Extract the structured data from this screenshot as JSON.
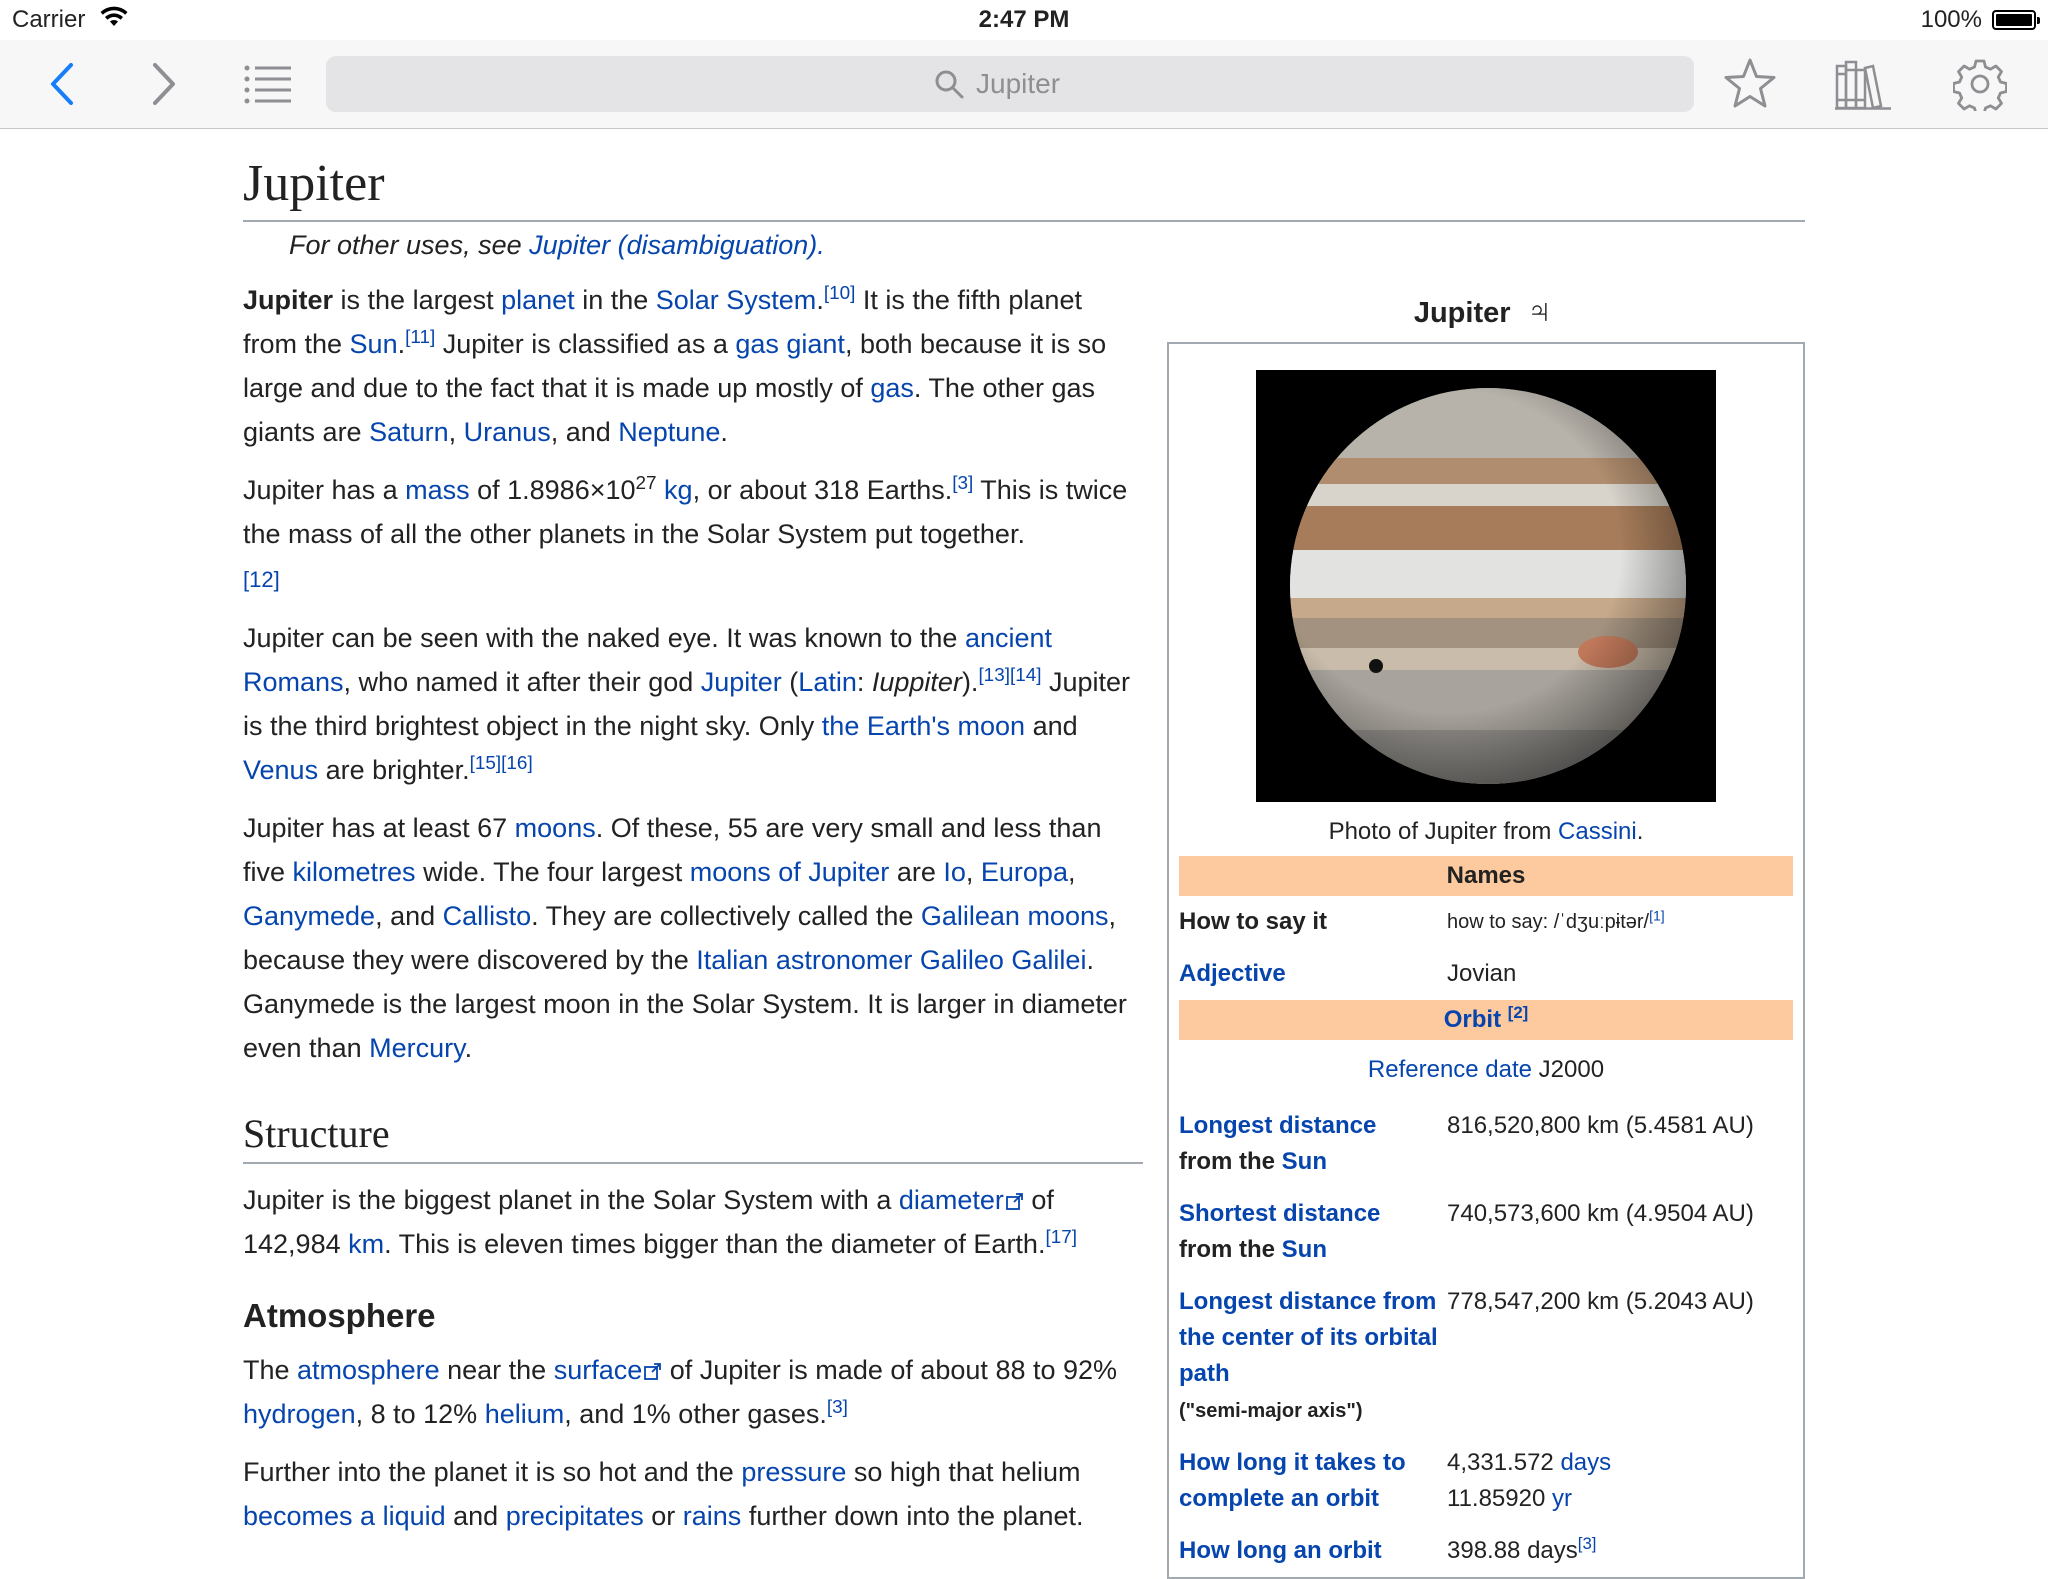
{
  "status": {
    "carrier": "Carrier",
    "time": "2:47 PM",
    "battery": "100%"
  },
  "toolbar": {
    "search_placeholder": "Jupiter"
  },
  "article": {
    "title": "Jupiter",
    "hatnote_pre": "For other uses, see ",
    "hatnote_link": "Jupiter (disambiguation).",
    "p1": {
      "bold": "Jupiter",
      "t1": " is the largest ",
      "l1": "planet",
      "t2": " in the ",
      "l2": "Solar System",
      "t3": ".",
      "r1": "[10]",
      "t4": " It is the fifth planet from the ",
      "l3": "Sun",
      "t5": ".",
      "r2": "[11]",
      "t6": " Jupiter is classified as a ",
      "l4": "gas giant",
      "t7": ", both because it is so large and due to the fact that it is made up mostly of ",
      "l5": "gas",
      "t8": ". The other gas giants are ",
      "l6": "Saturn",
      "t9": ", ",
      "l7": "Uranus",
      "t10": ", and ",
      "l8": "Neptune",
      "t11": "."
    },
    "p2": {
      "t1": "Jupiter has a ",
      "l1": "mass",
      "t2": " of 1.8986×10",
      "sup": "27",
      "t3": " ",
      "l2": "kg",
      "t4": ", or about 318 Earths.",
      "r1": "[3]",
      "t5": " This is twice the mass of all the other planets in the Solar System put together.",
      "r2": "[12]"
    },
    "p3": {
      "t1": "Jupiter can be seen with the naked eye. It was known to the ",
      "l1": "ancient Romans",
      "t2": ", who named it after their god ",
      "l2": "Jupiter",
      "t3": " (",
      "l3": "Latin",
      "t4": ": ",
      "i1": "Iuppiter",
      "t5": ").",
      "r1": "[13][14]",
      "t6": " Jupiter is the third brightest object in the night sky. Only ",
      "l4": "the Earth's moon",
      "t7": " and ",
      "l5": "Venus",
      "t8": " are brighter.",
      "r2": "[15][16]"
    },
    "p4": {
      "t1": "Jupiter has at least 67 ",
      "l1": "moons",
      "t2": ". Of these, 55 are very small and less than five ",
      "l2": "kilometres",
      "t3": " wide. The four largest ",
      "l3": "moons of Jupiter",
      "t4": " are ",
      "l4": "Io",
      "t5": ", ",
      "l5": "Europa",
      "t6": ", ",
      "l6": "Ganymede",
      "t7": ", and ",
      "l7": "Callisto",
      "t8": ". They are collectively called the ",
      "l8": "Galilean moons",
      "t9": ", because they were discovered by the ",
      "l9": "Italian astronomer Galileo Galilei",
      "t10": ". Ganymede is the largest moon in the Solar System. It is larger in diameter even than ",
      "l10": "Mercury",
      "t11": "."
    },
    "structure": {
      "heading": "Structure",
      "t1": "Jupiter is the biggest planet in the Solar System with a ",
      "l1": "diameter",
      "t2": " of 142,984 ",
      "l2": "km",
      "t3": ". This is eleven times bigger than the diameter of Earth.",
      "r1": "[17]"
    },
    "atmosphere": {
      "heading": "Atmosphere",
      "p1": {
        "t1": "The ",
        "l1": "atmosphere",
        "t2": " near the ",
        "l2": "surface",
        "t3": " of Jupiter is made of about 88 to 92% ",
        "l3": "hydrogen",
        "t4": ", 8 to 12% ",
        "l4": "helium",
        "t5": ", and 1% other gases.",
        "r1": "[3]"
      },
      "p2": {
        "t1": "Further into the planet it is so hot and the ",
        "l1": "pressure",
        "t2": " so high that helium ",
        "l2": "becomes a liquid",
        "t3": " and ",
        "l3": "precipitates",
        "t4": " or ",
        "l4": "rains",
        "t5": " further down into the planet."
      }
    }
  },
  "infobox": {
    "title": "Jupiter",
    "symbol": "♃",
    "caption_pre": "Photo of Jupiter from ",
    "caption_link": "Cassini",
    "caption_post": ".",
    "names_header": "Names",
    "how_to_say_label": "How to say it",
    "how_to_say_value": "how to say: /ˈdʒuːpɨtər/",
    "how_to_say_ref": "[1]",
    "adjective_label": "Adjective",
    "adjective_value": "Jovian",
    "orbit_header": "Orbit",
    "orbit_ref": "[2]",
    "ref_date_link": "Reference date",
    "ref_date_value": " J2000",
    "rows": [
      {
        "label_link": "Longest distance",
        "label_rest": "from the ",
        "label_link2": "Sun",
        "value": "816,520,800 km (5.4581 AU)"
      },
      {
        "label_link": "Shortest distance",
        "label_rest": "from the ",
        "label_link2": "Sun",
        "value": "740,573,600 km (4.9504 AU)"
      }
    ],
    "semi_major": {
      "label_link": "Longest distance from the center of its orbital path",
      "label_note": "(\"semi-major axis\")",
      "value": "778,547,200 km (5.2043 AU)"
    },
    "period": {
      "label_link": "How long it takes to complete an orbit",
      "v1": "4,331.572 ",
      "v1_link": "days",
      "v2": "11.85920 ",
      "v2_link": "yr"
    },
    "synodic": {
      "label_link": "How long an orbit",
      "value": "398.88 days",
      "ref": "[3]"
    }
  }
}
